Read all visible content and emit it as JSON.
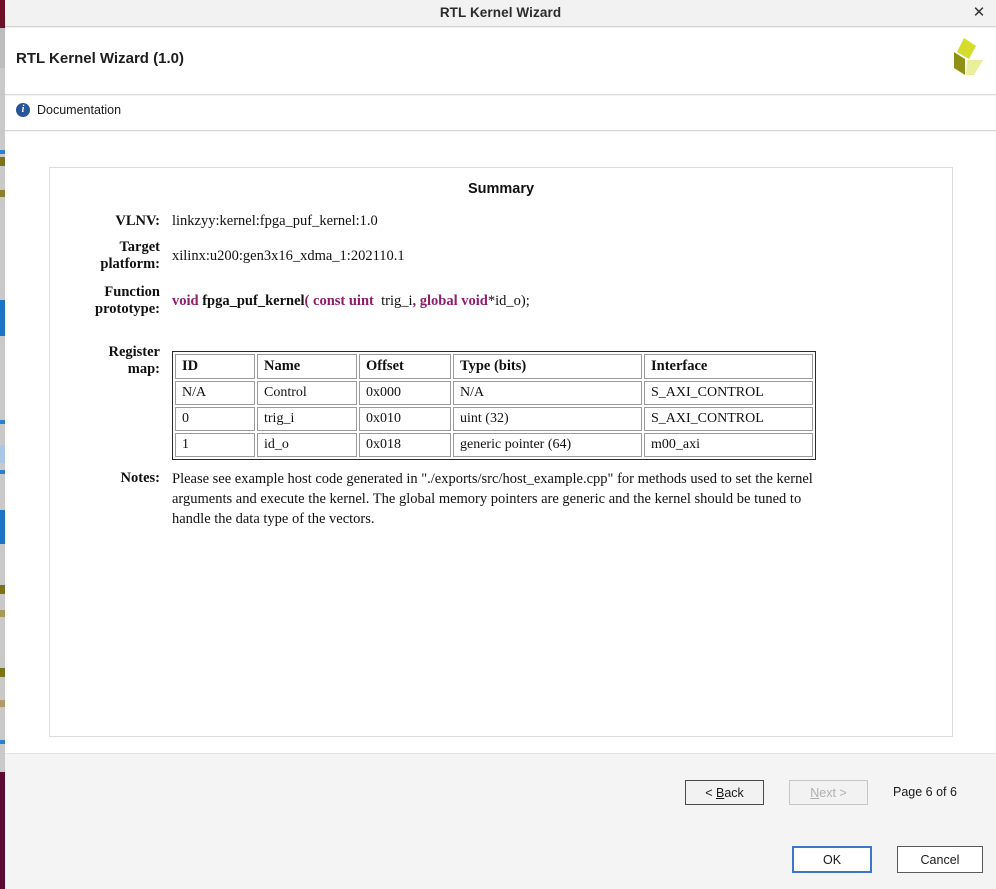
{
  "window": {
    "title": "RTL Kernel Wizard",
    "close_icon": "close-icon"
  },
  "header": {
    "title": "RTL Kernel Wizard (1.0)",
    "logo_icon": "xilinx-logo-icon",
    "logo_colors": {
      "top": "#d4dd2c",
      "left": "#8f9116",
      "right": "#e9ef9d"
    }
  },
  "doc_bar": {
    "icon": "info-icon",
    "icon_glyph": "i",
    "label": "Documentation"
  },
  "summary": {
    "title": "Summary",
    "fields": {
      "vlnv_label": "VLNV:",
      "vlnv_value": "linkzyy:kernel:fpga_puf_kernel:1.0",
      "platform_label_line1": "Target",
      "platform_label_line2": "platform:",
      "platform_value": "xilinx:u200:gen3x16_xdma_1:202110.1",
      "prototype_label_line1": "Function",
      "prototype_label_line2": "prototype:",
      "prototype_tokens": {
        "t1": "void",
        "t2": "fpga_puf_kernel",
        "t3": "(",
        "t4": "const uint",
        "t5": "trig_i",
        "t6": ",",
        "t7": "global void",
        "t8": "*id_o);"
      },
      "keyword_color": "#8e1d6b",
      "regmap_label_line1": "Register",
      "regmap_label_line2": "map:",
      "notes_label": "Notes:",
      "notes_value": "Please see example host code generated in \"./exports/src/host_example.cpp\" for methods used to set the kernel arguments and execute the kernel. The global memory pointers are generic and the kernel should be tuned to handle the data type of the vectors."
    },
    "register_map": {
      "columns": [
        "ID",
        "Name",
        "Offset",
        "Type (bits)",
        "Interface"
      ],
      "rows": [
        [
          "N/A",
          "Control",
          "0x000",
          "N/A",
          "S_AXI_CONTROL"
        ],
        [
          "0",
          "trig_i",
          "0x010",
          "uint (32)",
          "S_AXI_CONTROL"
        ],
        [
          "1",
          "id_o",
          "0x018",
          "generic pointer (64)",
          "m00_axi"
        ]
      ]
    }
  },
  "footer": {
    "back_pre": "< ",
    "back_mnem": "B",
    "back_post": "ack",
    "next_mnem": "N",
    "next_post": "ext >",
    "next_disabled": true,
    "page_label": "Page 6 of 6",
    "ok_label": "OK",
    "cancel_label": "Cancel",
    "focus_color": "#3b78c8"
  }
}
